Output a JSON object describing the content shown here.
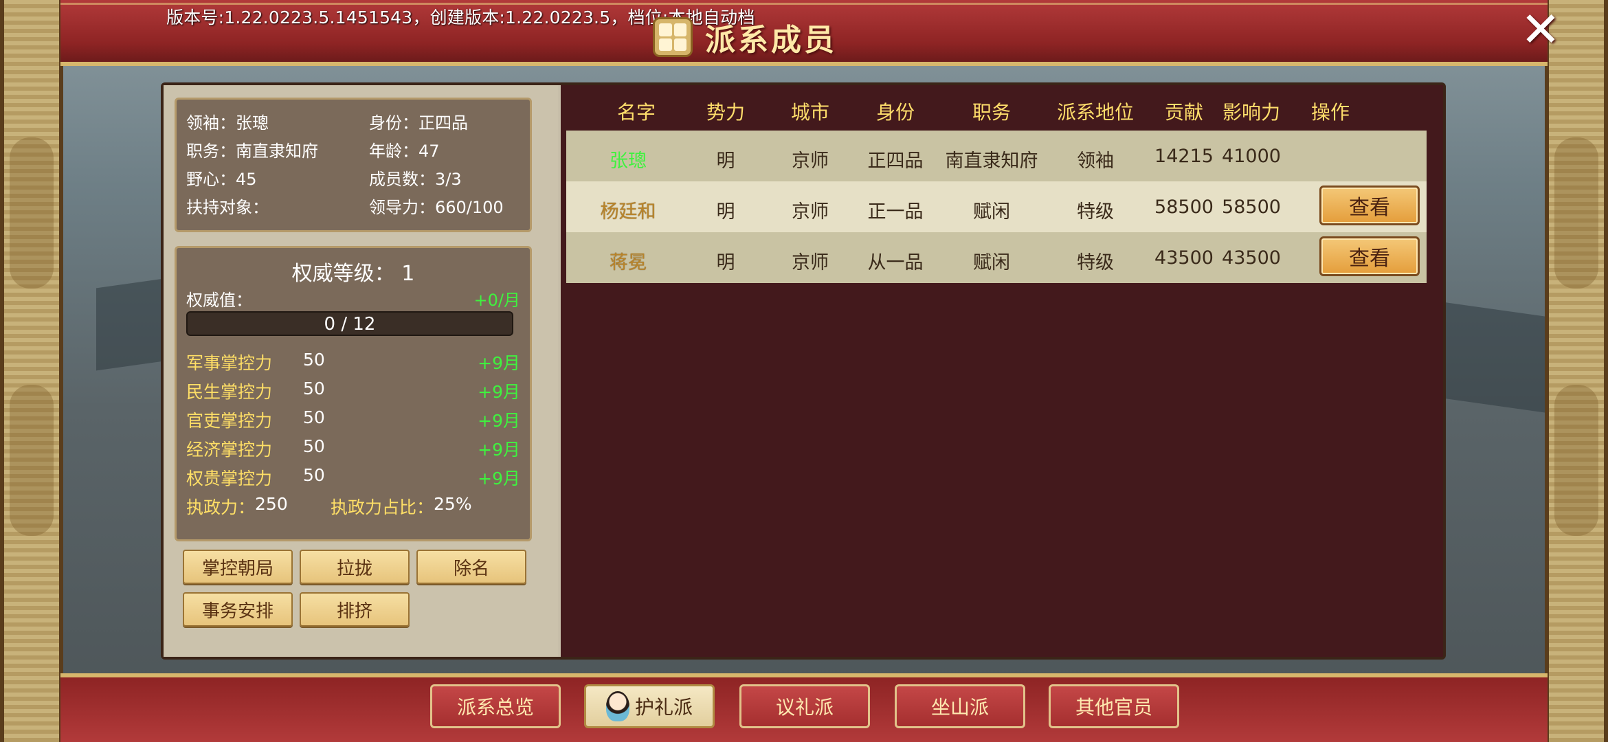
{
  "header": {
    "version": "版本号:1.22.0223.5.1451543，创建版本:1.22.0223.5，档位:本地自动档",
    "title": "派系成员",
    "close_label": "✕"
  },
  "leader_info": {
    "leader": "领袖：张璁",
    "rank": "身份：正四品",
    "post": "职务：南直隶知府",
    "age": "年龄：47",
    "ambition": "野心：45",
    "members": "成员数：3/3",
    "support": "扶持对象：",
    "leadership": "领导力：660/100"
  },
  "authority": {
    "level_label": "权威等级：",
    "level": "1",
    "value_label": "权威值：",
    "monthly": "+0/月",
    "progress_text": "0 / 12",
    "progress_fraction": 0.0,
    "controls": [
      {
        "name": "军事掌控力",
        "value": "50",
        "inc": "+9月"
      },
      {
        "name": "民生掌控力",
        "value": "50",
        "inc": "+9月"
      },
      {
        "name": "官吏掌控力",
        "value": "50",
        "inc": "+9月"
      },
      {
        "name": "经济掌控力",
        "value": "50",
        "inc": "+9月"
      },
      {
        "name": "权贵掌控力",
        "value": "50",
        "inc": "+9月"
      }
    ],
    "exec_label": "执政力：",
    "exec_value": "250",
    "exec_ratio_label": "执政力占比：",
    "exec_ratio": "25%"
  },
  "actions": {
    "control_court": "掌控朝局",
    "recruit": "拉拢",
    "expel": "除名",
    "arrange": "事务安排",
    "exclude": "排挤"
  },
  "table": {
    "headers": [
      "名字",
      "势力",
      "城市",
      "身份",
      "职务",
      "派系地位",
      "贡献",
      "影响力",
      "操作"
    ],
    "rows": [
      {
        "name": "张璁",
        "force": "明",
        "city": "京师",
        "rank": "正四品",
        "post": "南直隶知府",
        "status": "领袖",
        "contrib": "14215",
        "influence": "41000",
        "action": ""
      },
      {
        "name": "杨廷和",
        "force": "明",
        "city": "京师",
        "rank": "正一品",
        "post": "赋闲",
        "status": "特级",
        "contrib": "58500",
        "influence": "58500",
        "action": "查看"
      },
      {
        "name": "蒋冕",
        "force": "明",
        "city": "京师",
        "rank": "从一品",
        "post": "赋闲",
        "status": "特级",
        "contrib": "43500",
        "influence": "43500",
        "action": "查看"
      }
    ]
  },
  "tabs": {
    "overview": "派系总览",
    "huli": "护礼派",
    "yili": "议礼派",
    "zuoshan": "坐山派",
    "others": "其他官员"
  },
  "colors": {
    "accent_gold": "#ffde6b",
    "green_value": "#3ff23f",
    "panel_dark": "#43191c",
    "banner_red": "#b23a3a"
  }
}
